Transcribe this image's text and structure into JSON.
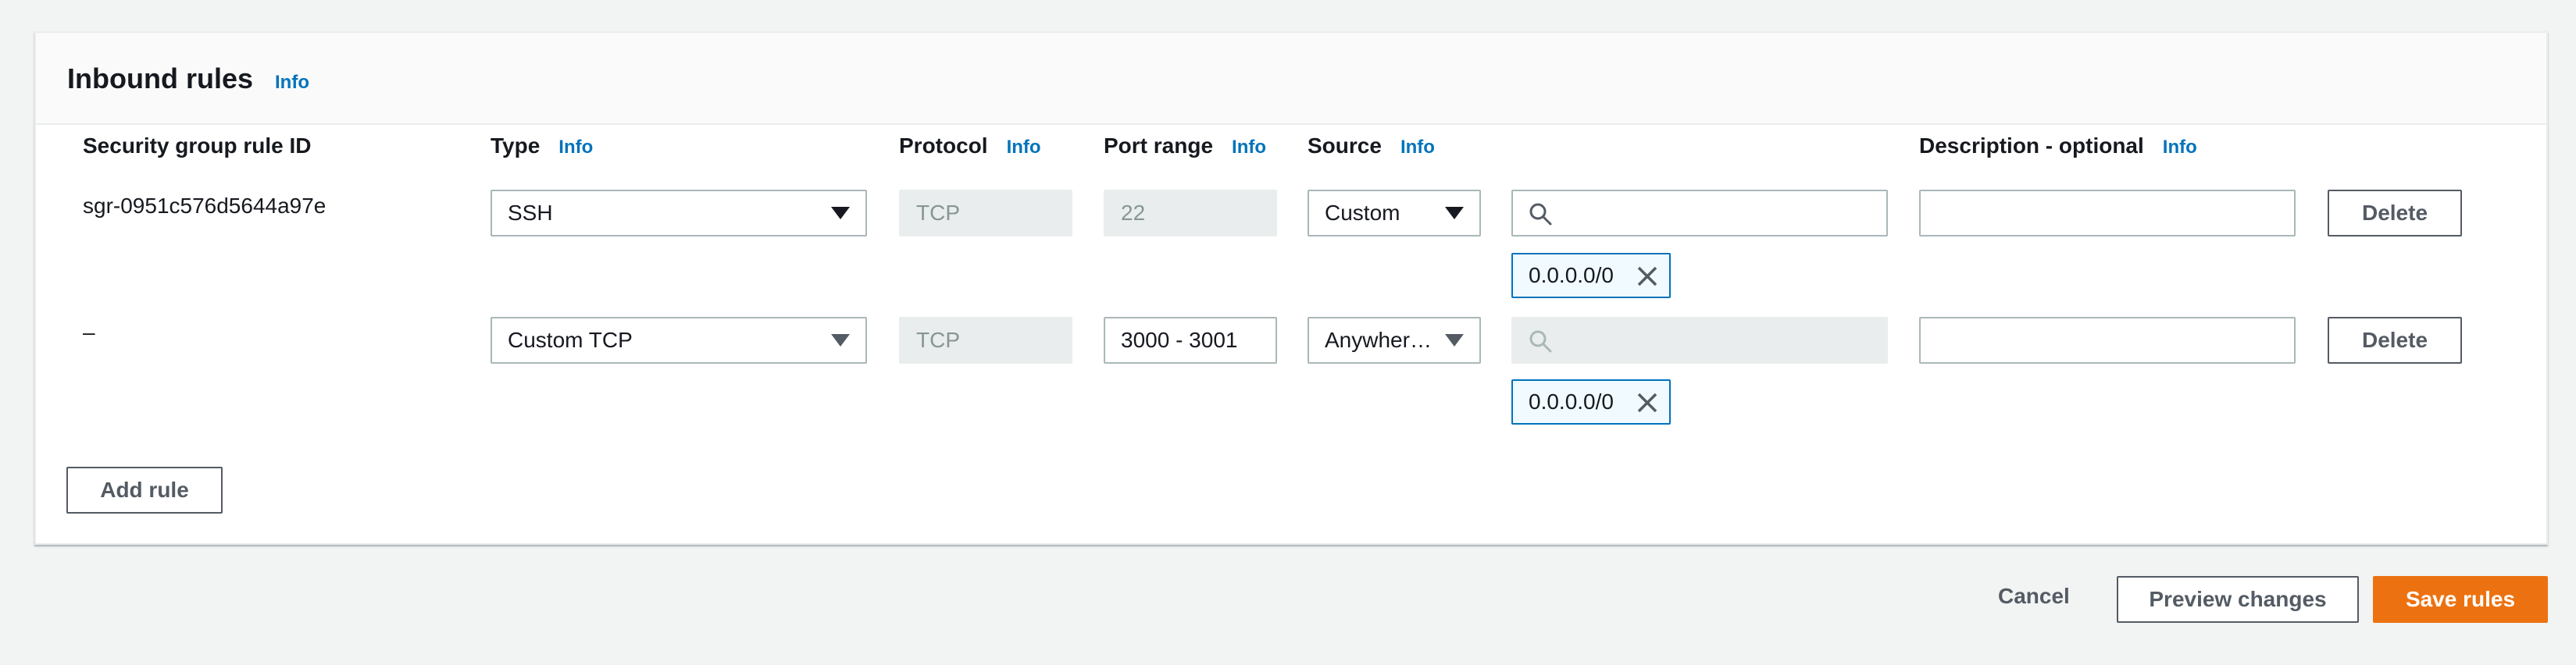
{
  "panel": {
    "title": "Inbound rules",
    "info_label": "Info"
  },
  "columns": {
    "rule_id": "Security group rule ID",
    "type": "Type",
    "protocol": "Protocol",
    "port_range": "Port range",
    "source": "Source",
    "description": "Description - optional",
    "info_label": "Info"
  },
  "rules": [
    {
      "rule_id": "sgr-0951c576d5644a97e",
      "type": "SSH",
      "protocol": "TCP",
      "port_range": "22",
      "source": "Custom",
      "search_value": "",
      "token": "0.0.0.0/0",
      "description": "",
      "delete_label": "Delete"
    },
    {
      "rule_id": "–",
      "type": "Custom TCP",
      "protocol": "TCP",
      "port_range": "3000 - 3001",
      "source": "Anywher…",
      "search_value": "",
      "token": "0.0.0.0/0",
      "description": "",
      "delete_label": "Delete"
    }
  ],
  "add_rule_label": "Add rule",
  "footer": {
    "cancel_label": "Cancel",
    "preview_label": "Preview changes",
    "save_label": "Save rules"
  }
}
